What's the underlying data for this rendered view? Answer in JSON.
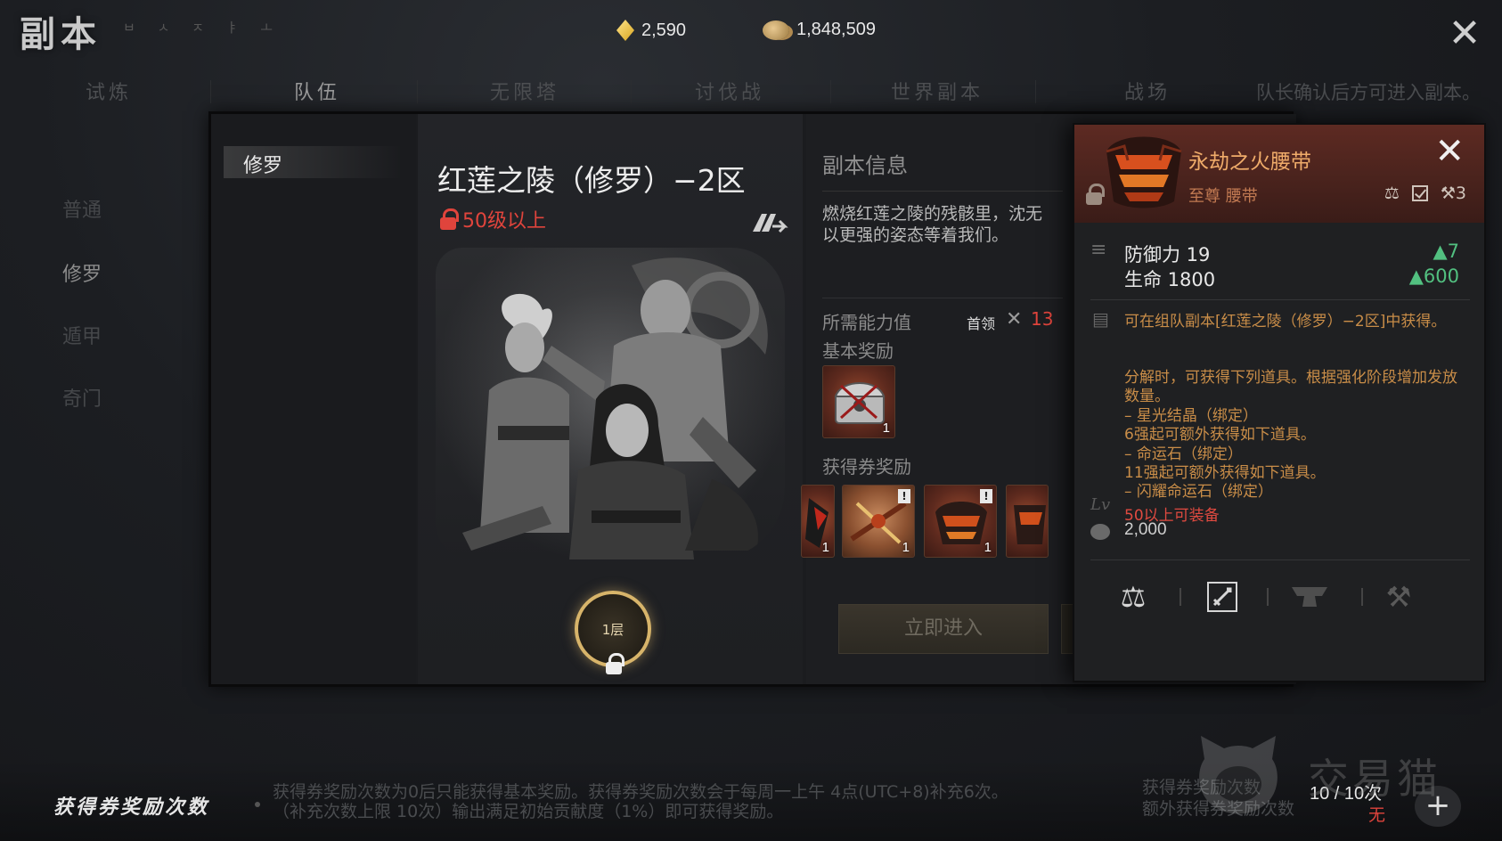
{
  "header": {
    "title": "副本",
    "subtitle": "ㅂ ㅅ ㅈ ㅑ ㅗ",
    "diamonds": "2,590",
    "gold": "1,848,509"
  },
  "tabs": [
    "试炼",
    "队伍",
    "无限塔",
    "讨伐战",
    "世界副本",
    "战场"
  ],
  "active_tab": 1,
  "notice": "队长确认后方可进入副本。",
  "categories": [
    "普通",
    "修罗",
    "遁甲",
    "奇门"
  ],
  "difficulty": {
    "selected": "修罗"
  },
  "dungeon": {
    "name": "红莲之陵（修罗）−2区",
    "level_req": "50级以上",
    "floor": "1层"
  },
  "info": {
    "title": "副本信息",
    "description": "燃烧红莲之陵的残骸里，沈无\n以更强的姿态等着我们。",
    "required_label": "所需能力值",
    "boss_label": "首领",
    "boss_value": "13",
    "basic_reward_label": "基本奖励",
    "basic_reward_qty": "1",
    "ticket_reward_label": "获得券奖励",
    "ticket_rewards": [
      {
        "qty": "1",
        "mark": ""
      },
      {
        "qty": "1",
        "mark": "!"
      },
      {
        "qty": "1",
        "mark": "!"
      },
      {
        "qty": "",
        "mark": ""
      }
    ],
    "enter_button": "立即进入"
  },
  "tooltip": {
    "name": "永劫之火腰带",
    "type": "至尊 腰带",
    "upgrade_count": "3",
    "stats": [
      {
        "name": "防御力 19",
        "diff": "▲7"
      },
      {
        "name": "生命 1800",
        "diff": "▲600"
      }
    ],
    "obtain": "可在组队副本[红莲之陵（修罗）−2区]中获得。",
    "decompose": "分解时，可获得下列道具。根据强化阶段增加发放数量。\n– 星光结晶（绑定）\n6强起可额外获得如下道具。\n– 命运石（绑定）\n11强起可额外获得如下道具。\n– 闪耀命运石（绑定）",
    "equip_req": "50以上可装备",
    "price": "2,000",
    "colors": {
      "name": "#f0ac6a",
      "desc": "#c98d48",
      "warn": "#e04a40",
      "up": "#52c080"
    }
  },
  "bottom": {
    "title": "获得券奖励次数",
    "description": "获得券奖励次数为0后只能获得基本奖励。获得券奖励次数会于每周一上午 4点(UTC+8)补充6次。\n（补充次数上限 10次）输出满足初始贡献度（1%）即可获得奖励。",
    "label1": "获得券奖励次数",
    "label2": "额外获得券奖励次数",
    "count": "10 / 10次",
    "extra": "无"
  },
  "watermark": "交易猫"
}
